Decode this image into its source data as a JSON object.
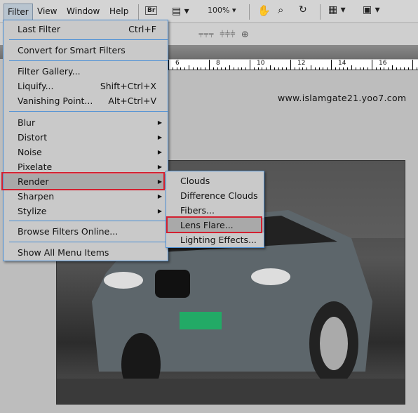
{
  "menubar": {
    "items": [
      "Filter",
      "View",
      "Window",
      "Help"
    ],
    "bridge": "Br",
    "zoom": "100%"
  },
  "ruler": [
    "6",
    "8",
    "10",
    "12",
    "14",
    "16"
  ],
  "watermark": "www.islamgate21.yoo7.com",
  "filter_menu": {
    "last_filter": {
      "label": "Last Filter",
      "shortcut": "Ctrl+F"
    },
    "convert": "Convert for Smart Filters",
    "gallery": "Filter Gallery...",
    "liquify": {
      "label": "Liquify...",
      "shortcut": "Shift+Ctrl+X"
    },
    "vanishing": {
      "label": "Vanishing Point...",
      "shortcut": "Alt+Ctrl+V"
    },
    "submenus": [
      "Blur",
      "Distort",
      "Noise",
      "Pixelate",
      "Render",
      "Sharpen",
      "Stylize"
    ],
    "browse": "Browse Filters Online...",
    "show_all": "Show All Menu Items"
  },
  "render_submenu": [
    "Clouds",
    "Difference Clouds",
    "Fibers...",
    "Lens Flare...",
    "Lighting Effects..."
  ],
  "colors": {
    "highlight_box": "#d32030",
    "menu_border": "#4a8fd6"
  }
}
